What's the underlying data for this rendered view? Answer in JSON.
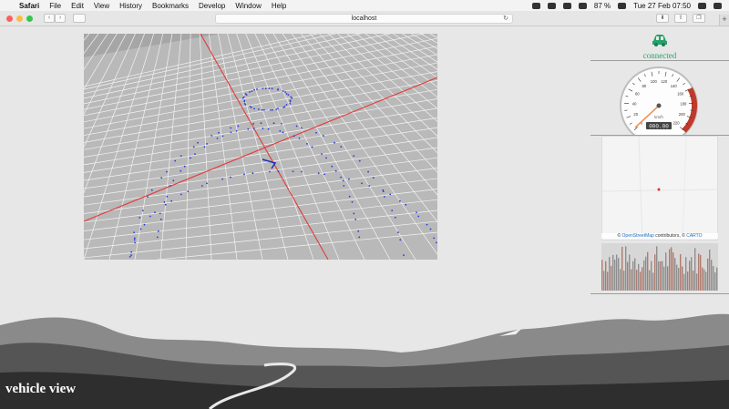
{
  "menubar": {
    "app_name": "Safari",
    "menus": [
      "File",
      "Edit",
      "View",
      "History",
      "Bookmarks",
      "Develop",
      "Window",
      "Help"
    ],
    "battery": "87 %",
    "datetime": "Tue 27 Feb  07:50"
  },
  "browser": {
    "url": "localhost"
  },
  "status": {
    "label": "connected",
    "color": "#27a36a"
  },
  "speedometer": {
    "ticks": [
      "0",
      "20",
      "40",
      "60",
      "80",
      "100",
      "120",
      "140",
      "160",
      "180",
      "200",
      "220"
    ],
    "unit": "km/h",
    "readout": "000.00",
    "redline_color": "#c0392b"
  },
  "map": {
    "attribution_prefix": "©",
    "attribution_osm": "OpenStreetMap",
    "attribution_mid": "contributors, ©",
    "attribution_carto": "CARTO",
    "marker_color": "#e0322b"
  },
  "page": {
    "caption": "vehicle view"
  }
}
